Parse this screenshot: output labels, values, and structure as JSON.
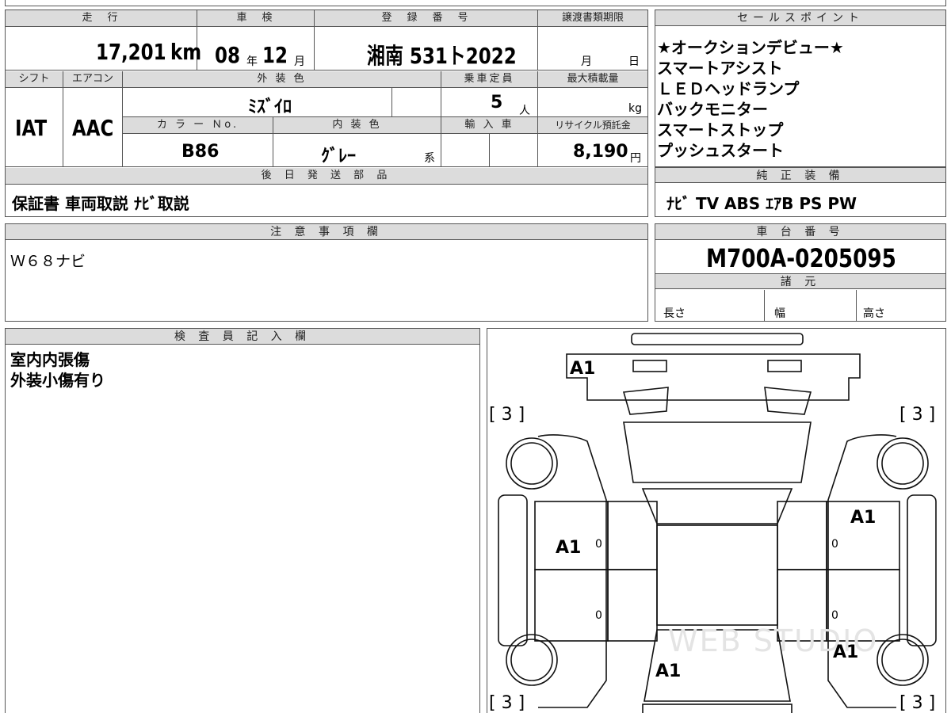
{
  "top_strip": "",
  "main": {
    "mileage": {
      "label": "走　行",
      "value": "17,201",
      "unit": "km"
    },
    "inspection": {
      "label": "車　検",
      "year": "08",
      "year_unit": "年",
      "month": "12",
      "month_unit": "月"
    },
    "registration": {
      "label": "登　録　番　号",
      "value": "湘南 531ト2022"
    },
    "transfer_deadline": {
      "label": "譲渡書類期限",
      "month_unit": "月",
      "day_unit": "日"
    },
    "shift": {
      "label": "シフト",
      "value": "IAT"
    },
    "aircon": {
      "label": "エアコン",
      "value": "AAC"
    },
    "exterior_color": {
      "label": "外 装 色",
      "value": "ﾐｽﾞｲﾛ"
    },
    "capacity": {
      "label": "乗車定員",
      "value": "5",
      "unit": "人"
    },
    "max_load": {
      "label": "最大積載量",
      "unit": "kg"
    },
    "color_no": {
      "label": "カ ラ ー Ｎo.",
      "value": "B86"
    },
    "interior_color": {
      "label": "内 装 色",
      "value": "ｸﾞﾚｰ",
      "suffix": "系"
    },
    "import": {
      "label": "輸 入 車"
    },
    "recycle": {
      "label": "リサイクル預託金",
      "value": "8,190",
      "unit": "円"
    },
    "shipping_parts": {
      "label": "後 日 発 送 部 品",
      "value": "保証書 車両取説 ﾅﾋﾞ取説"
    }
  },
  "sales_points": {
    "label": "セールスポイント",
    "items": [
      "★オークションデビュー★",
      "スマートアシスト",
      "ＬＥＤヘッドランプ",
      "バックモニター",
      "スマートストップ",
      "プッシュスタート"
    ]
  },
  "equipment": {
    "label": "純 正 装 備",
    "value": "ﾅﾋﾞ TV ABS ｴｱB PS PW"
  },
  "notes": {
    "label": "注 意 事 項 欄",
    "value": "Ｗ６８ナビ"
  },
  "chassis": {
    "label": "車 台 番 号",
    "value": "M700A-0205095"
  },
  "specs": {
    "label": "諸 元",
    "length": "長さ",
    "width": "幅",
    "height": "高さ"
  },
  "inspector": {
    "label": "検 査 員 記 入 欄",
    "lines": [
      "室内内張傷",
      "外装小傷有り"
    ]
  },
  "diagram": {
    "watermark": "WEB STUDIO",
    "marks": {
      "front": "A1",
      "left_front_door": "A1",
      "right_front_door": "A1",
      "right_rear": "A1",
      "rear": "A1",
      "tire_fl": "[ 3 ]",
      "tire_fr": "[ 3 ]",
      "tire_rl": "[ 3 ]",
      "tire_rr": "[ 3 ]",
      "zero": "0"
    }
  }
}
